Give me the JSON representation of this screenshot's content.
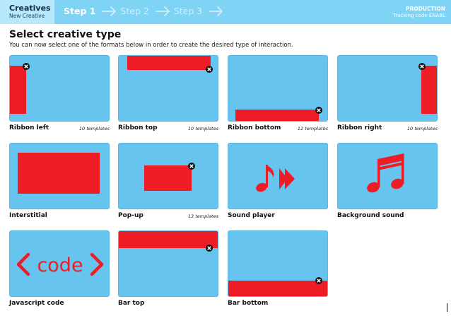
{
  "header": {
    "brand_title": "Creatives",
    "brand_subtitle": "New Creative",
    "steps": [
      {
        "label": "Step 1",
        "active": true
      },
      {
        "label": "Step 2",
        "active": false
      },
      {
        "label": "Step 3",
        "active": false
      }
    ],
    "environment": "PRODUCTION",
    "tracking": "Tracking code ENABL"
  },
  "main": {
    "title": "Select creative type",
    "description": "You can now select one of the formats below in order to create the desired type of interaction."
  },
  "tiles": [
    {
      "label": "Ribbon left",
      "count": "10 templates",
      "icon": "ribbon-left"
    },
    {
      "label": "Ribbon top",
      "count": "10 templates",
      "icon": "ribbon-top"
    },
    {
      "label": "Ribbon bottom",
      "count": "12 templates",
      "icon": "ribbon-bottom"
    },
    {
      "label": "Ribbon right",
      "count": "10 templates",
      "icon": "ribbon-right"
    },
    {
      "label": "Interstitial",
      "count": "",
      "icon": "interstitial"
    },
    {
      "label": "Pop-up",
      "count": "13 templates",
      "icon": "popup"
    },
    {
      "label": "Sound player",
      "count": "",
      "icon": "sound-player"
    },
    {
      "label": "Background sound",
      "count": "",
      "icon": "music-note"
    },
    {
      "label": "Javascript code",
      "count": "",
      "icon": "code"
    },
    {
      "label": "Bar top",
      "count": "",
      "icon": "bar-top"
    },
    {
      "label": "Bar bottom",
      "count": "",
      "icon": "bar-bottom"
    }
  ],
  "colors": {
    "header_bg": "#7fd3f5",
    "tile_bg": "#67c4ee",
    "accent_red": "#ee1c25"
  }
}
